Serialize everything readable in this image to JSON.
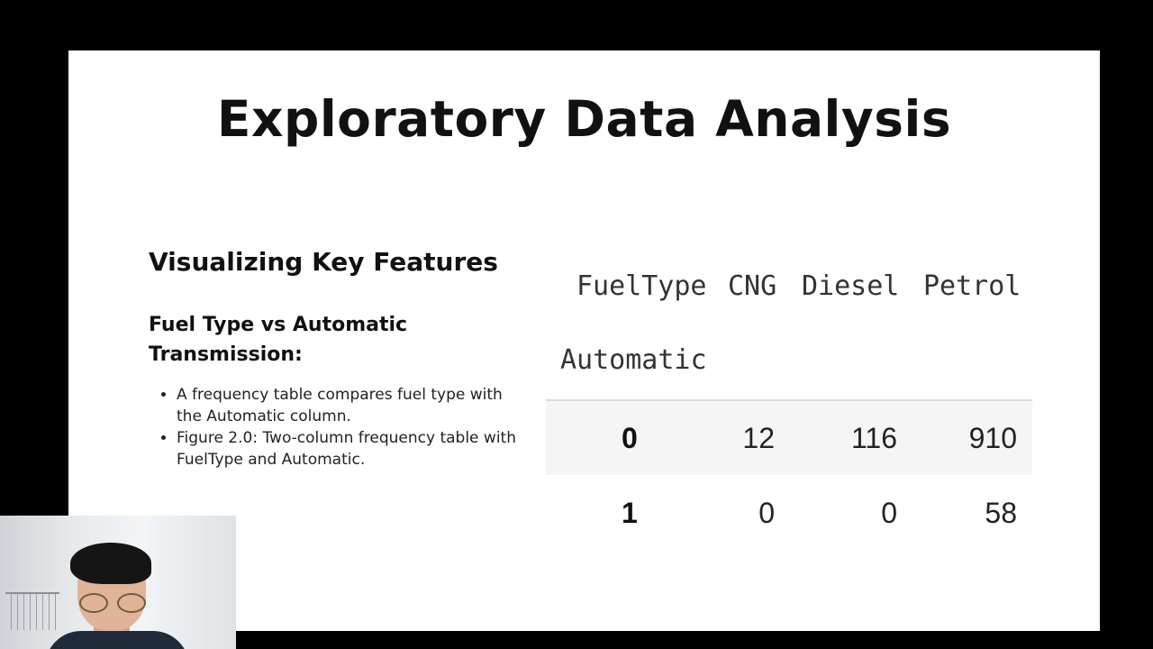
{
  "slide": {
    "title": "Exploratory Data Analysis",
    "section_heading": "Visualizing Key Features",
    "sub_heading": "Fuel Type vs Automatic Transmission:",
    "bullets": [
      "A frequency table compares fuel type with the Automatic column.",
      "Figure 2.0: Two-column frequency table with FuelType and Automatic."
    ]
  },
  "frequency_table": {
    "column_axis_label": "FuelType",
    "row_axis_label": "Automatic",
    "columns": [
      "CNG",
      "Diesel",
      "Petrol"
    ],
    "rows": [
      {
        "index": "0",
        "values": [
          "12",
          "116",
          "910"
        ]
      },
      {
        "index": "1",
        "values": [
          "0",
          "0",
          "58"
        ]
      }
    ]
  },
  "colors": {
    "background": "#000000",
    "slide": "#ffffff",
    "text": "#111111",
    "table_row_shade": "#f5f5f5"
  },
  "webcam": {
    "icon": "presenter-webcam"
  }
}
